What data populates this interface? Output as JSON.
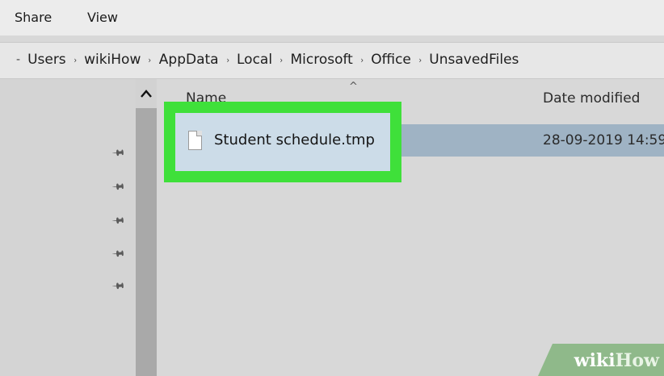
{
  "ribbon": {
    "tabs": [
      "Share",
      "View"
    ]
  },
  "address": {
    "lead": "-",
    "crumbs": [
      "Users",
      "wikiHow",
      "AppData",
      "Local",
      "Microsoft",
      "Office",
      "UnsavedFiles"
    ],
    "separator": "›"
  },
  "nav_pane": {
    "pinned_icon": "pin-icon",
    "pinned_count": 5
  },
  "scrollbar": {
    "up_arrow": "^"
  },
  "columns": {
    "name": "Name",
    "date_modified": "Date modified",
    "sort_indicator": "^"
  },
  "file": {
    "name": "Student schedule.tmp",
    "date_modified": "28-09-2019 14:59",
    "icon": "document-icon"
  },
  "watermark": {
    "part1": "wiki",
    "part2": "How"
  },
  "colors": {
    "highlight": "#3fe03a",
    "selection": "#9fb3c4"
  }
}
